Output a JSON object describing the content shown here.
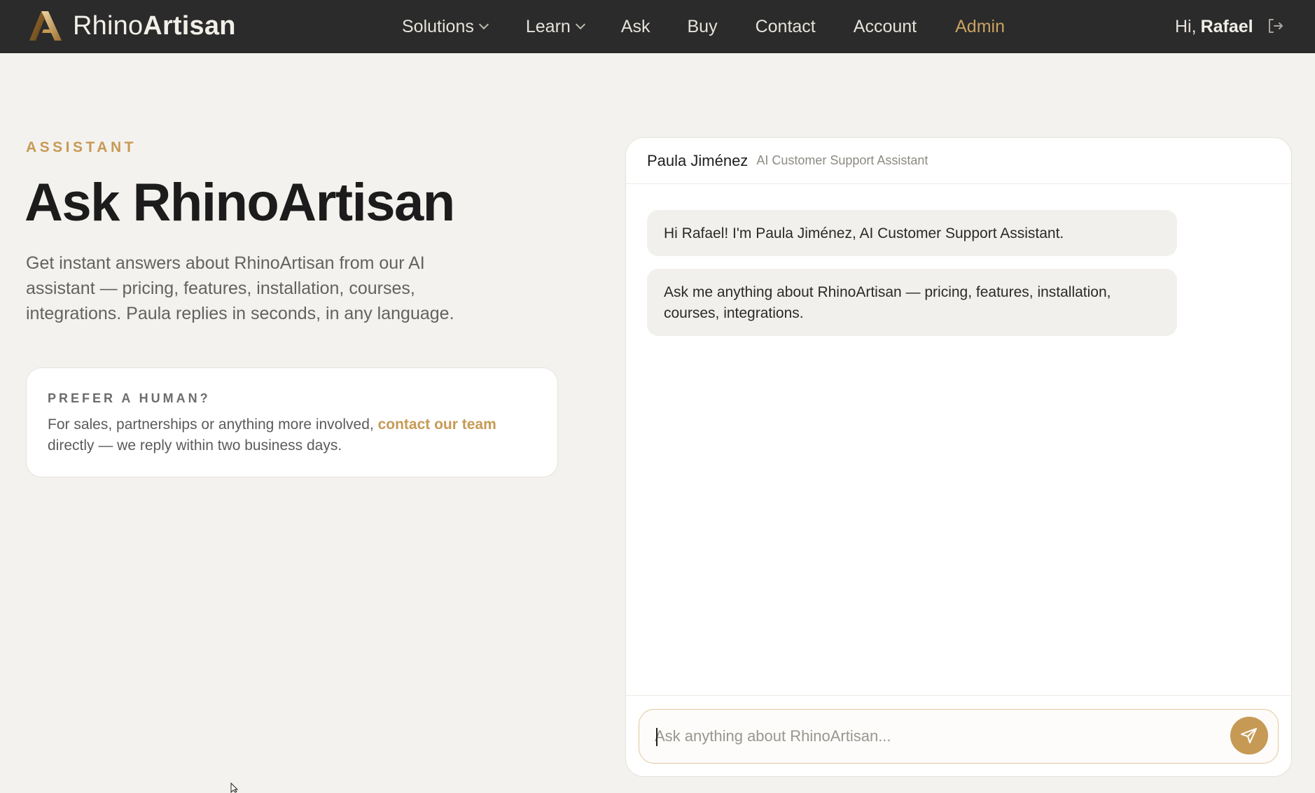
{
  "nav": {
    "logo_prefix": "Rhino",
    "logo_suffix": "Artisan",
    "items": [
      {
        "label": "Solutions",
        "has_dropdown": true
      },
      {
        "label": "Learn",
        "has_dropdown": true
      },
      {
        "label": "Ask"
      },
      {
        "label": "Buy"
      },
      {
        "label": "Contact"
      },
      {
        "label": "Account"
      },
      {
        "label": "Admin",
        "active": true
      }
    ],
    "greeting_prefix": "Hi,",
    "user_name": "Rafael",
    "logout_icon": "logout-icon"
  },
  "hero": {
    "eyebrow": "ASSISTANT",
    "title": "Ask RhinoArtisan",
    "lead": "Get instant answers about RhinoArtisan from our AI assistant — pricing, features, installation, courses, integrations. Paula replies in seconds, in any language."
  },
  "human_card": {
    "eyebrow": "PREFER A HUMAN?",
    "text_before": "For sales, partnerships or anything more involved, ",
    "link_text": "contact our team",
    "text_after": " directly — we reply within two business days."
  },
  "chat": {
    "agent_name": "Paula Jiménez",
    "agent_role": "AI Customer Support Assistant",
    "messages": [
      {
        "text": "Hi Rafael! I'm Paula Jiménez, AI Customer Support Assistant."
      },
      {
        "text": "Ask me anything about RhinoArtisan — pricing, features, installation, courses, integrations."
      }
    ],
    "input_placeholder": "Ask anything about RhinoArtisan...",
    "input_value": "",
    "send_icon": "send-icon"
  },
  "colors": {
    "nav_bg": "#2b2b2b",
    "page_bg": "#f4f2ee",
    "accent": "#c69a55",
    "bubble_bg": "#f2f0ec"
  }
}
